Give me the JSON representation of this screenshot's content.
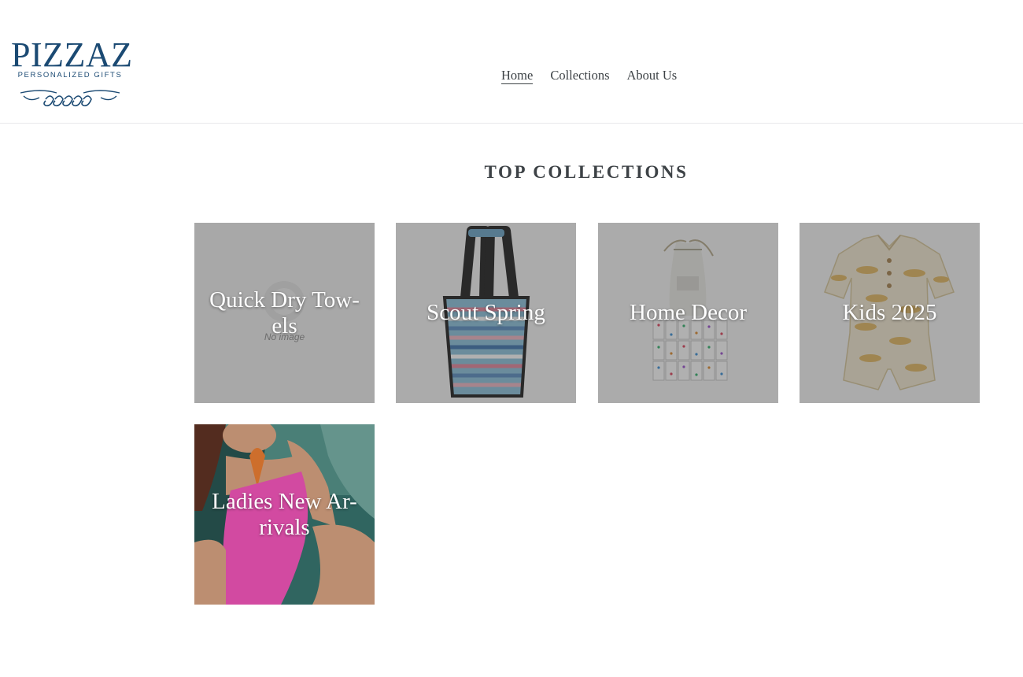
{
  "brand": {
    "name": "PIZZAZ",
    "tagline": "PERSONALIZED GIFTS",
    "color": "#1b4a73"
  },
  "nav": {
    "items": [
      {
        "label": "Home",
        "active": true
      },
      {
        "label": "Collections",
        "active": false
      },
      {
        "label": "About Us",
        "active": false
      }
    ]
  },
  "main": {
    "section_title": "TOP COLLECTIONS",
    "collections": [
      {
        "label": "Quick Dry Tow-\nels",
        "image": "no-image-placeholder",
        "placeholder_text": "No image"
      },
      {
        "label": "Scout Spring",
        "image": "striped-tote-bag"
      },
      {
        "label": "Home Decor",
        "image": "dominoes-set-with-bag"
      },
      {
        "label": "Kids 2025",
        "image": "fish-print-romper"
      },
      {
        "label": "Ladies New Ar-\nrivals",
        "image": "pink-swimsuit-model"
      }
    ]
  },
  "colors": {
    "text": "#3d4246",
    "overlay": "rgba(58,58,58,0.4)",
    "tile_label": "#ffffff"
  }
}
